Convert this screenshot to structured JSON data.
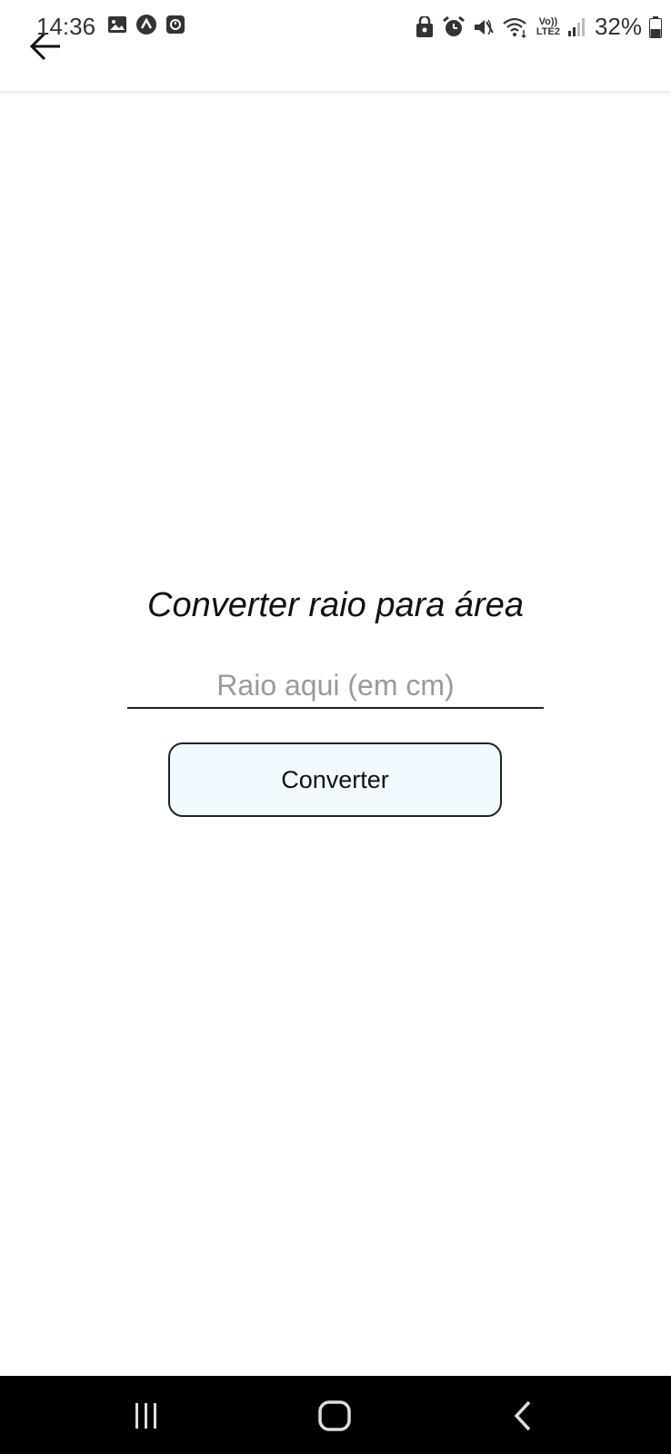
{
  "status_bar": {
    "time": "14:36",
    "battery_percent": "32%",
    "network_label_top": "Vo))",
    "network_label_bottom": "LTE2",
    "left_icons": [
      "image-icon",
      "app-a-icon",
      "app-square-icon"
    ],
    "right_icons": [
      "lock-icon",
      "alarm-icon",
      "mute-icon",
      "wifi-icon",
      "signal-icon",
      "battery-icon"
    ]
  },
  "header": {
    "back_icon": "arrow-left-icon"
  },
  "main": {
    "title": "Converter raio para área",
    "input": {
      "placeholder": "Raio aqui (em cm)",
      "value": ""
    },
    "convert_button_label": "Converter"
  },
  "nav_bar": {
    "buttons": [
      "recent-apps-icon",
      "home-icon",
      "back-icon"
    ]
  },
  "colors": {
    "button_bg": "#f2f9ff",
    "nav_bg": "#000000",
    "placeholder": "#9a9a9a"
  }
}
